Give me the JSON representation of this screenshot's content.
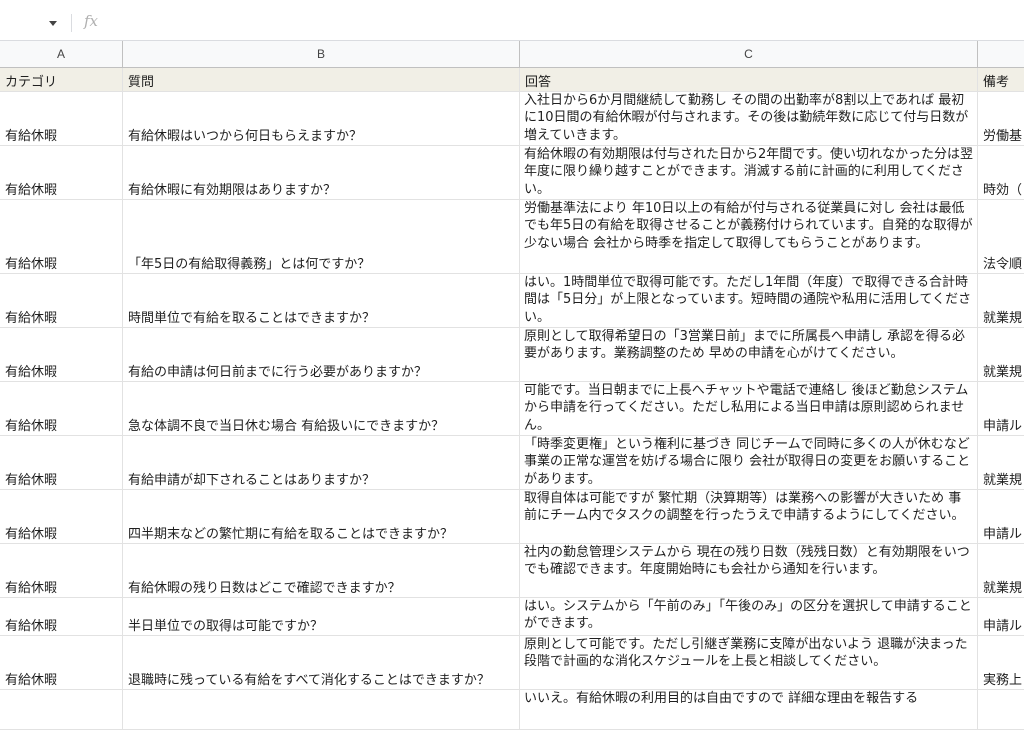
{
  "formula_bar": {
    "fx_label": "fx",
    "content": ""
  },
  "columns": [
    "A",
    "B",
    "C"
  ],
  "header_row": {
    "category": "カテゴリ",
    "question": "質問",
    "answer": "回答",
    "notes": "備考"
  },
  "rows": [
    {
      "category": "有給休暇",
      "question": "有給休暇はいつから何日もらえますか？",
      "answer": "入社日から6か月間継続して勤務し その間の出勤率が8割以上であれば 最初に10日間の有給休暇が付与されます。その後は勤続年数に応じて付与日数が増えていきます。",
      "notes": "労働基"
    },
    {
      "category": "有給休暇",
      "question": "有給休暇に有効期限はありますか？",
      "answer": "有給休暇の有効期限は付与された日から2年間です。使い切れなかった分は翌年度に限り繰り越すことができます。消滅する前に計画的に利用してください。",
      "notes": "時効（"
    },
    {
      "category": "有給休暇",
      "question": "「年5日の有給取得義務」とは何ですか？",
      "answer": "労働基準法により 年10日以上の有給が付与される従業員に対し 会社は最低でも年5日の有給を取得させることが義務付けられています。自発的な取得が少ない場合 会社から時季を指定して取得してもらうことがあります。",
      "notes": "法令順"
    },
    {
      "category": "有給休暇",
      "question": "時間単位で有給を取ることはできますか？",
      "answer": "はい。1時間単位で取得可能です。ただし1年間（年度）で取得できる合計時間は「5日分」が上限となっています。短時間の通院や私用に活用してください。",
      "notes": "就業規"
    },
    {
      "category": "有給休暇",
      "question": "有給の申請は何日前までに行う必要がありますか？",
      "answer": "原則として取得希望日の「3営業日前」までに所属長へ申請し 承認を得る必要があります。業務調整のため 早めの申請を心がけてください。",
      "notes": "就業規"
    },
    {
      "category": "有給休暇",
      "question": "急な体調不良で当日休む場合 有給扱いにできますか？",
      "answer": "可能です。当日朝までに上長へチャットや電話で連絡し 後ほど勤怠システムから申請を行ってください。ただし私用による当日申請は原則認められません。",
      "notes": "申請ル"
    },
    {
      "category": "有給休暇",
      "question": "有給申請が却下されることはありますか？",
      "answer": "「時季変更権」という権利に基づき 同じチームで同時に多くの人が休むなど 事業の正常な運営を妨げる場合に限り 会社が取得日の変更をお願いすることがあります。",
      "notes": "就業規"
    },
    {
      "category": "有給休暇",
      "question": "四半期末などの繁忙期に有給を取ることはできますか？",
      "answer": "取得自体は可能ですが 繁忙期（決算期等）は業務への影響が大きいため 事前にチーム内でタスクの調整を行ったうえで申請するようにしてください。",
      "notes": "申請ル"
    },
    {
      "category": "有給休暇",
      "question": "有給休暇の残り日数はどこで確認できますか？",
      "answer": "社内の勤怠管理システムから 現在の残り日数（残残日数）と有効期限をいつでも確認できます。年度開始時にも会社から通知を行います。",
      "notes": "就業規"
    },
    {
      "category": "有給休暇",
      "question": "半日単位での取得は可能ですか？",
      "answer": "はい。システムから「午前のみ」「午後のみ」の区分を選択して申請することができます。",
      "notes": "申請ル"
    },
    {
      "category": "有給休暇",
      "question": "退職時に残っている有給をすべて消化することはできますか？",
      "answer": "原則として可能です。ただし引継ぎ業務に支障が出ないよう 退職が決まった段階で計画的な消化スケジュールを上長と相談してください。",
      "notes": "実務上"
    },
    {
      "category": "",
      "question": "",
      "answer": "いいえ。有給休暇の利用目的は自由ですので 詳細な理由を報告する",
      "notes": ""
    }
  ]
}
